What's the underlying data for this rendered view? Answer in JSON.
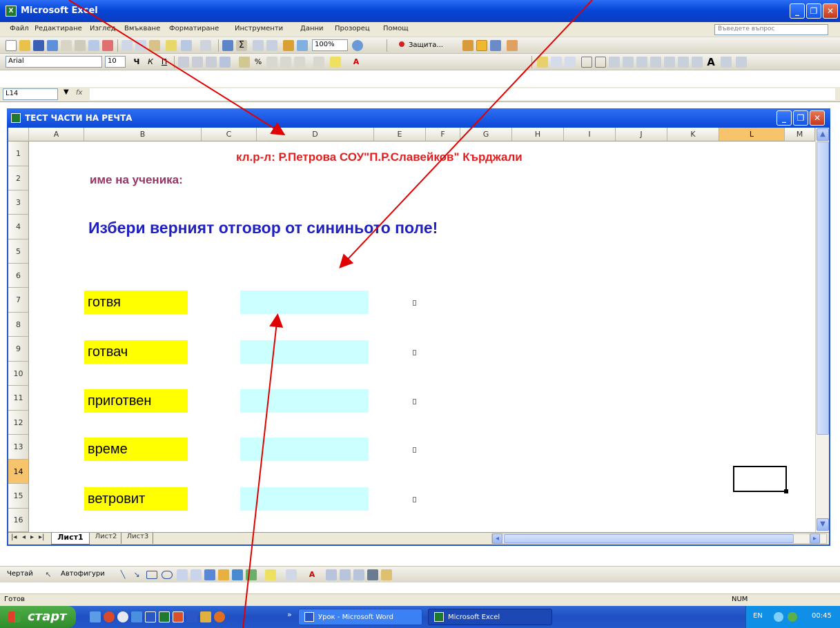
{
  "window": {
    "title": "Microsoft Excel",
    "icon": "X"
  },
  "menu": [
    "Файл",
    "Редактиране",
    "Изглед",
    "Вмъкване",
    "Форматиране",
    "Инструменти",
    "Данни",
    "Прозорец",
    "Помощ"
  ],
  "help_placeholder": "Въведете въпрос",
  "toolbar": {
    "zoom": "100%",
    "protect_label": "Защита...",
    "font": "Arial",
    "font_size": "10"
  },
  "formula": {
    "name_box": "L14",
    "fx": "fx",
    "value": ""
  },
  "workbook": {
    "title": "ТЕСТ ЧАСТИ НА РЕЧТА"
  },
  "columns": [
    "A",
    "B",
    "C",
    "D",
    "E",
    "F",
    "G",
    "H",
    "I",
    "J",
    "K",
    "L",
    "M"
  ],
  "active_col": "L",
  "rows": [
    "1",
    "2",
    "3",
    "4",
    "5",
    "6",
    "7",
    "8",
    "9",
    "10",
    "11",
    "12",
    "13",
    "14",
    "15",
    "16"
  ],
  "active_row": "14",
  "sheet": {
    "header": "кл.р-л: Р.Петрова СОУ\"П.Р.Славейков\" Кърджали",
    "student_label": "име на ученика:",
    "instruction": "Избери верният отговор от сининьото поле!",
    "words": [
      "готвя",
      "готвач",
      "приготвен",
      "време",
      "ветровит"
    ]
  },
  "tabs": [
    "Лист1",
    "Лист2",
    "Лист3"
  ],
  "drawing": {
    "draw_label": "Чертай",
    "autoshapes_label": "Автофигури"
  },
  "status": {
    "ready": "Готов",
    "num": "NUM"
  },
  "taskbar": {
    "start": "старт",
    "tasks": [
      "Урок - Microsoft Word",
      "Microsoft Excel"
    ],
    "lang": "EN",
    "clock": "00:45"
  }
}
